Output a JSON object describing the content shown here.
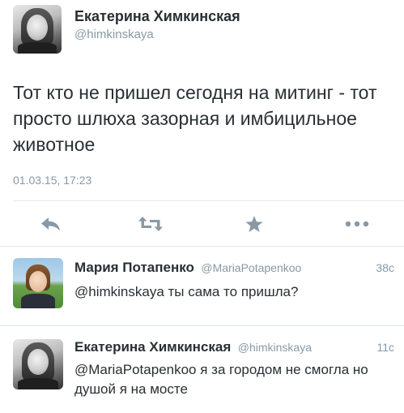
{
  "main_tweet": {
    "author_name": "Екатерина Химкинская",
    "author_handle": "@himkinskaya",
    "text": "Тот кто не пришел сегодня на митинг - тот просто шлюха зазорная и имбицильное животное",
    "timestamp": "01.03.15, 17:23"
  },
  "actions": {
    "reply_icon": "reply-icon",
    "retweet_icon": "retweet-icon",
    "favorite_icon": "star-icon",
    "more_icon": "more-dots-icon",
    "icon_color": "#8899a6"
  },
  "replies": [
    {
      "author_name": "Мария Потапенко",
      "author_handle": "@MariaPotapenkoo",
      "time": "38с",
      "text": "@himkinskaya ты сама то пришла?"
    },
    {
      "author_name": "Екатерина Химкинская",
      "author_handle": "@himkinskaya",
      "time": "11с",
      "text": "@MariaPotapenkoo я за городом не смогла но душой я на мосте"
    }
  ],
  "colors": {
    "text": "#292f33",
    "secondary": "#8899a6",
    "divider": "#e1e8ed"
  }
}
